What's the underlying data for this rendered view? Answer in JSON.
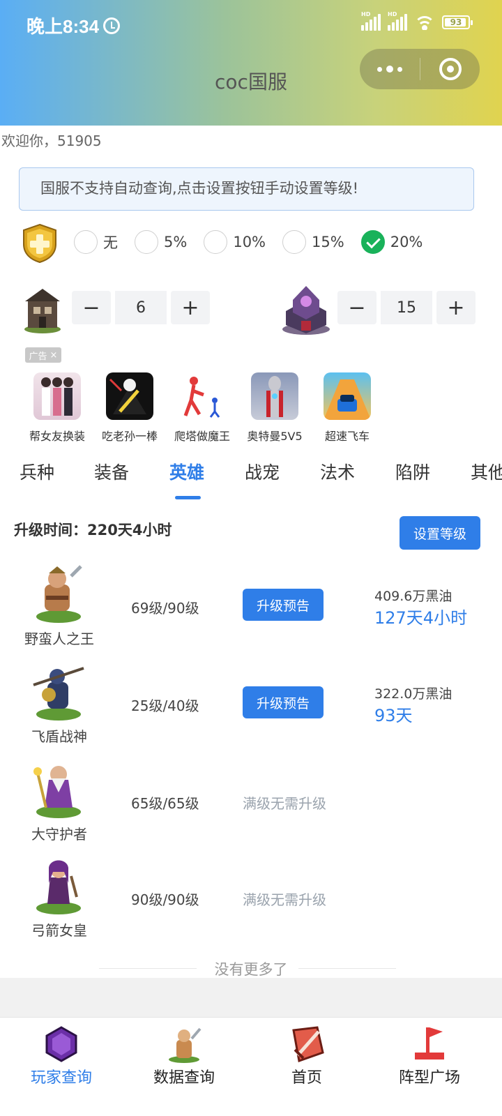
{
  "status_bar": {
    "time": "晚上8:34",
    "battery": "93",
    "battery_level": 0.93
  },
  "nav": {
    "title": "coc国服"
  },
  "welcome": "欢迎你，51905",
  "notice": "国服不支持自动查询,点击设置按钮手动设置等级!",
  "percent_options": [
    {
      "label": "无",
      "checked": false
    },
    {
      "label": "5%",
      "checked": false
    },
    {
      "label": "10%",
      "checked": false
    },
    {
      "label": "15%",
      "checked": false
    },
    {
      "label": "20%",
      "checked": true
    }
  ],
  "steppers": {
    "builder_hall": {
      "minus": "−",
      "value": "6",
      "plus": "+"
    },
    "town_hall": {
      "minus": "−",
      "value": "15",
      "plus": "+"
    }
  },
  "ad": {
    "tag": "广告",
    "close": "×",
    "items": [
      {
        "name": "帮女友换装"
      },
      {
        "name": "吃老孙一棒"
      },
      {
        "name": "爬塔做魔王"
      },
      {
        "name": "奥特曼5V5"
      },
      {
        "name": "超速飞车"
      }
    ]
  },
  "tabs": [
    {
      "label": "兵种",
      "active": false
    },
    {
      "label": "装备",
      "active": false
    },
    {
      "label": "英雄",
      "active": true
    },
    {
      "label": "战宠",
      "active": false
    },
    {
      "label": "法术",
      "active": false
    },
    {
      "label": "陷阱",
      "active": false
    },
    {
      "label": "其他",
      "active": false
    }
  ],
  "upgrade_time": "升级时间：220天4小时",
  "set_level_button": "设置等级",
  "heroes": [
    {
      "name": "野蛮人之王",
      "level": "69级/90级",
      "button": "升级预告",
      "cost": "409.6万黑油",
      "duration": "127天4小时"
    },
    {
      "name": "飞盾战神",
      "level": "25级/40级",
      "button": "升级预告",
      "cost": "322.0万黑油",
      "duration": "93天"
    },
    {
      "name": "大守护者",
      "level": "65级/65级",
      "maxed": "满级无需升级"
    },
    {
      "name": "弓箭女皇",
      "level": "90级/90级",
      "maxed": "满级无需升级"
    }
  ],
  "no_more": "没有更多了",
  "tabbar": [
    {
      "label": "玩家查询",
      "active": true
    },
    {
      "label": "数据查询",
      "active": false
    },
    {
      "label": "首页",
      "active": false
    },
    {
      "label": "阵型广场",
      "active": false
    }
  ],
  "colors": {
    "accent": "#2f7ee8",
    "checked": "#19b25a"
  }
}
